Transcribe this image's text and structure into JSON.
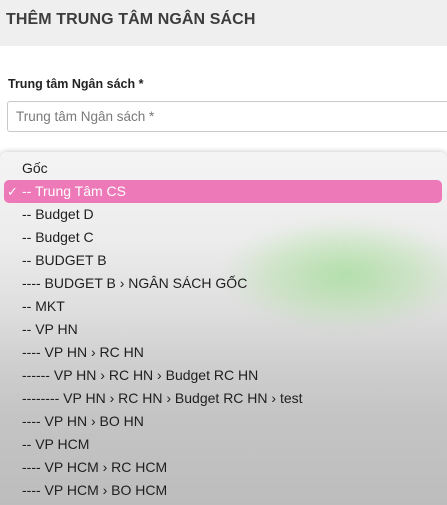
{
  "header": {
    "title": "THÊM TRUNG TÂM NGÂN SÁCH"
  },
  "form": {
    "field_label": "Trung tâm Ngân sách *",
    "placeholder": "Trung tâm Ngân sách *",
    "value": ""
  },
  "dropdown": {
    "selected_index": 1,
    "check_glyph": "✓",
    "selected_color": "#ee79b8",
    "options": [
      "Gốc",
      "-- Trung Tâm CS",
      "-- Budget D",
      "-- Budget C",
      "-- BUDGET B",
      "---- BUDGET B › NGÂN SÁCH GỐC",
      "-- MKT",
      "-- VP HN",
      "---- VP HN › RC HN",
      "------ VP HN › RC HN › Budget RC HN",
      "-------- VP HN › RC HN › Budget RC HN › test",
      "---- VP HN › BO HN",
      "-- VP HCM",
      "---- VP HCM › RC HCM",
      "---- VP HCM › BO HCM"
    ]
  }
}
